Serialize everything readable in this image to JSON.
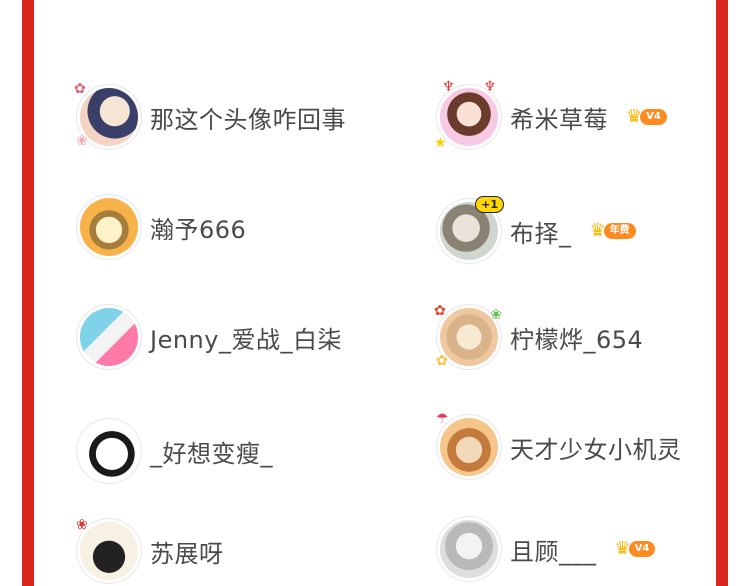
{
  "colors": {
    "frame": "#d9261c",
    "text": "#4a4a4a",
    "badge": "#ff8a1f",
    "crown": "#ffb400"
  },
  "users": [
    {
      "name": "那这个头像咋回事",
      "avatar_icon": "girl-sketch-avatar",
      "badge": null,
      "plus_one": null
    },
    {
      "name": "希米草莓",
      "avatar_icon": "devil-girl-avatar",
      "badge": "V4",
      "plus_one": null
    },
    {
      "name": "瀚予666",
      "avatar_icon": "cartoon-boy-avatar",
      "badge": null,
      "plus_one": null
    },
    {
      "name": "布择_",
      "avatar_icon": "girl-photo-avatar",
      "badge": "年费",
      "plus_one": "+1"
    },
    {
      "name": "Jenny_爱战_白柒",
      "avatar_icon": "new-pick-avatar",
      "badge": null,
      "plus_one": null
    },
    {
      "name": "柠檬烨_654",
      "avatar_icon": "flower-frame-avatar",
      "badge": null,
      "plus_one": null
    },
    {
      "name": "_好想变瘦_",
      "avatar_icon": "manga-boy-avatar",
      "badge": null,
      "plus_one": null
    },
    {
      "name": "天才少女小机灵",
      "avatar_icon": "girl-umbrella-avatar",
      "badge": null,
      "plus_one": null
    },
    {
      "name": "苏展呀",
      "avatar_icon": "black-cat-avatar",
      "badge": null,
      "plus_one": null
    },
    {
      "name": "且顾___",
      "avatar_icon": "silver-hair-avatar",
      "badge": "V4",
      "plus_one": null
    }
  ]
}
